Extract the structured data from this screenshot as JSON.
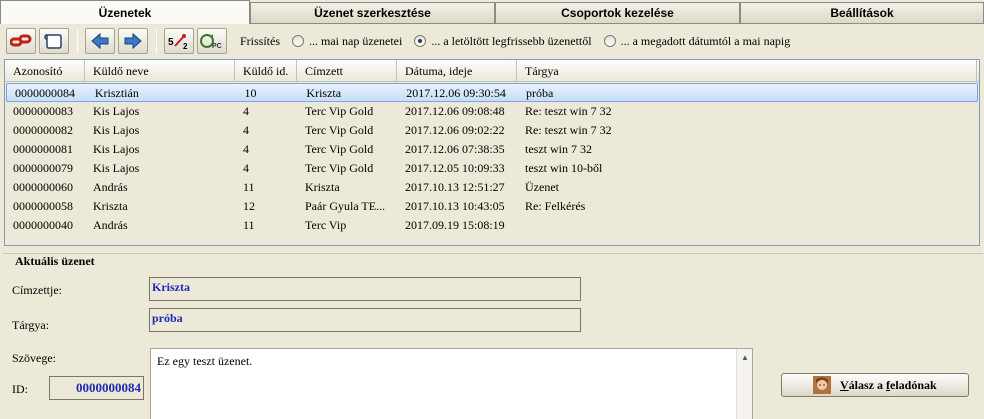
{
  "tabs": [
    {
      "label": "Üzenetek",
      "active": true
    },
    {
      "label": "Üzenet szerkesztése",
      "active": false
    },
    {
      "label": "Csoportok kezelése",
      "active": false
    },
    {
      "label": "Beállítások",
      "active": false
    }
  ],
  "toolbar": {
    "buttons": [
      {
        "icon": "link-icon"
      },
      {
        "icon": "scroll-icon"
      },
      {
        "icon": "arrow-left-icon"
      },
      {
        "icon": "arrow-right-icon"
      },
      {
        "icon": "sort-5-2-icon",
        "text": "5"
      },
      {
        "icon": "pc-refresh-icon",
        "text": "PC"
      }
    ],
    "refresh_label": "Frissítés",
    "radio": [
      {
        "label": "... mai nap üzenetei",
        "checked": false
      },
      {
        "label": "... a letöltött legfrissebb üzenettől",
        "checked": true
      },
      {
        "label": "... a megadott dátumtól a mai napig",
        "checked": false
      }
    ]
  },
  "table": {
    "columns": [
      "Azonosító",
      "Küldő neve",
      "Küldő id.",
      "Címzett",
      "Dátuma, ideje",
      "Tárgya"
    ],
    "rows": [
      [
        "0000000084",
        "Krisztián",
        "10",
        "Kriszta",
        "2017.12.06 09:30:54",
        "próba"
      ],
      [
        "0000000083",
        "Kis Lajos",
        "4",
        "Terc Vip Gold",
        "2017.12.06 09:08:48",
        "Re: teszt win 7 32"
      ],
      [
        "0000000082",
        "Kis Lajos",
        "4",
        "Terc Vip Gold",
        "2017.12.06 09:02:22",
        "Re: teszt win 7 32"
      ],
      [
        "0000000081",
        "Kis Lajos",
        "4",
        "Terc Vip Gold",
        "2017.12.06 07:38:35",
        "teszt win 7 32"
      ],
      [
        "0000000079",
        "Kis Lajos",
        "4",
        "Terc Vip Gold",
        "2017.12.05 10:09:33",
        "teszt win 10-ből"
      ],
      [
        "0000000060",
        "András",
        "11",
        "Kriszta",
        "2017.10.13 12:51:27",
        "Üzenet"
      ],
      [
        "0000000058",
        "Kriszta",
        "12",
        "Paár Gyula TE...",
        "2017.10.13 10:43:05",
        "Re: Felkérés"
      ],
      [
        "0000000040",
        "András",
        "11",
        "Terc Vip",
        "2017.09.19 15:08:19",
        ""
      ]
    ],
    "selected_row": 0
  },
  "current": {
    "title": "Aktuális üzenet",
    "recipient_label": "Címzettje:",
    "recipient": "Kriszta",
    "subject_label": "Tárgya:",
    "subject": "próba",
    "body_label": "Szövege:",
    "body": "Ez egy teszt üzenet.",
    "id_label": "ID:",
    "id": "0000000084",
    "reply_label_underlined": "V",
    "reply_label_mid": "álasz a ",
    "reply_label_underlined2": "f",
    "reply_label_rest": "eladónak"
  }
}
